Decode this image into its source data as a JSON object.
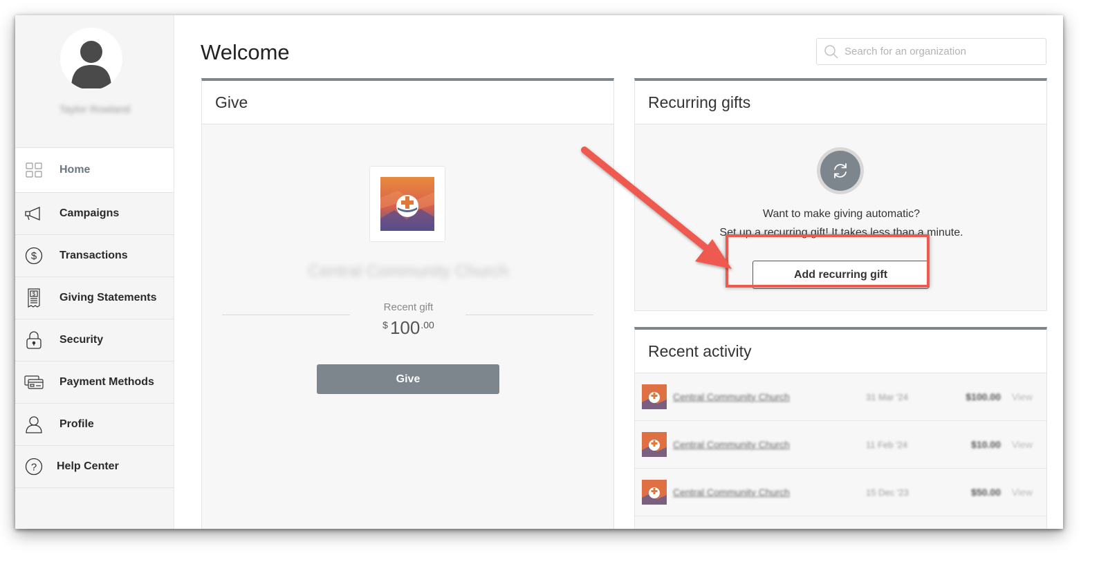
{
  "user": {
    "name": "Taylor Rowland"
  },
  "sidebar": {
    "items": [
      {
        "label": "Home",
        "icon": "grid-icon",
        "active": true
      },
      {
        "label": "Campaigns",
        "icon": "megaphone-icon"
      },
      {
        "label": "Transactions",
        "icon": "dollar-circle-icon"
      },
      {
        "label": "Giving Statements",
        "icon": "receipt-icon"
      },
      {
        "label": "Security",
        "icon": "lock-icon"
      },
      {
        "label": "Payment Methods",
        "icon": "credit-card-icon"
      },
      {
        "label": "Profile",
        "icon": "person-icon"
      },
      {
        "label": "Help Center",
        "icon": "question-circle-icon"
      }
    ]
  },
  "header": {
    "title": "Welcome",
    "search_placeholder": "Search for an organization"
  },
  "give": {
    "title": "Give",
    "org_name": "Central Community Church",
    "recent_gift_label": "Recent gift",
    "currency": "$",
    "amount_whole": "100",
    "amount_cents": ".00",
    "button_label": "Give"
  },
  "recurring": {
    "title": "Recurring gifts",
    "line1": "Want to make giving automatic?",
    "line2": "Set up a recurring gift! It takes less than a minute.",
    "button_label": "Add recurring gift"
  },
  "activity": {
    "title": "Recent activity",
    "rows": [
      {
        "org": "Central Community Church",
        "date": "31 Mar '24",
        "amount": "$100.00",
        "action": "View"
      },
      {
        "org": "Central Community Church",
        "date": "11 Feb '24",
        "amount": "$10.00",
        "action": "View"
      },
      {
        "org": "Central Community Church",
        "date": "15 Dec '23",
        "amount": "$50.00",
        "action": "View"
      }
    ]
  },
  "colors": {
    "accent_gray": "#7d868c",
    "annotation_red": "#ee5a4f"
  }
}
